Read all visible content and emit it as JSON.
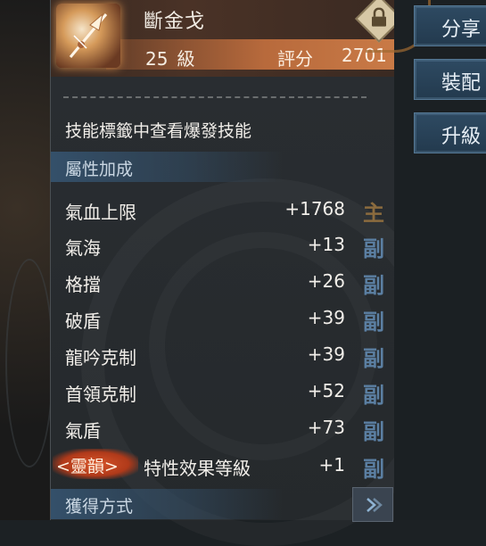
{
  "item": {
    "name": "斷金戈",
    "level_value": "25",
    "level_unit": "級",
    "score_label": "評分",
    "score_value": "2701",
    "locked": true
  },
  "skill_note": "技能標籤中查看爆發技能",
  "sections": {
    "attributes": "屬性加成",
    "acquisition": "獲得方式"
  },
  "attributes": [
    {
      "name": "氣血上限",
      "value": "+1768",
      "tag": "主",
      "tag_type": "main"
    },
    {
      "name": "氣海",
      "value": "+13",
      "tag": "副",
      "tag_type": "sub"
    },
    {
      "name": "格擋",
      "value": "+26",
      "tag": "副",
      "tag_type": "sub"
    },
    {
      "name": "破盾",
      "value": "+39",
      "tag": "副",
      "tag_type": "sub"
    },
    {
      "name": "龍吟克制",
      "value": "+39",
      "tag": "副",
      "tag_type": "sub"
    },
    {
      "name": "首領克制",
      "value": "+52",
      "tag": "副",
      "tag_type": "sub"
    },
    {
      "name": "氣盾",
      "value": "+73",
      "tag": "副",
      "tag_type": "sub"
    }
  ],
  "special": {
    "badge": "<靈韻>",
    "name": "特性效果等級",
    "value": "+1",
    "tag": "副"
  },
  "side_buttons": {
    "share": "分享",
    "equip": "裝配",
    "upgrade": "升級"
  },
  "colors": {
    "main_tag": "#8b6b3e",
    "sub_tag": "#5b7fa2",
    "section_bg": "#34506a",
    "soul_badge": "#d8552a"
  }
}
